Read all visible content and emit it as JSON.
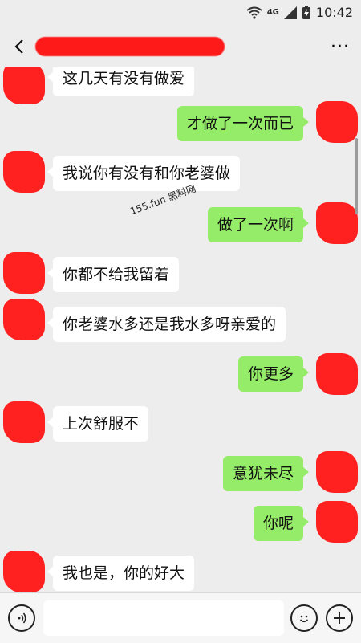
{
  "status_bar": {
    "network": "4G",
    "time": "10:42"
  },
  "icons": {
    "back": "back-chevron-icon",
    "more": "more-dots-icon",
    "wifi": "wifi-icon",
    "signal": "signal-icon",
    "battery": "battery-charging-icon",
    "voice": "voice-icon",
    "emoji": "emoji-icon",
    "plus": "plus-icon"
  },
  "watermark": "155.fun 黑料网",
  "messages": [
    {
      "side": "in",
      "text": "这几天有没有做爱"
    },
    {
      "side": "out",
      "text": "才做了一次而已"
    },
    {
      "side": "in",
      "text": "我说你有没有和你老婆做"
    },
    {
      "side": "out",
      "text": "做了一次啊"
    },
    {
      "side": "in",
      "text": "你都不给我留着"
    },
    {
      "side": "in",
      "text": "你老婆水多还是我水多呀亲爱的"
    },
    {
      "side": "out",
      "text": "你更多"
    },
    {
      "side": "in",
      "text": "上次舒服不"
    },
    {
      "side": "out",
      "text": "意犹未尽"
    },
    {
      "side": "out",
      "text": "你呢"
    },
    {
      "side": "in",
      "text": "我也是，你的好大"
    }
  ],
  "colors": {
    "background": "#ededed",
    "incoming_bubble": "#ffffff",
    "outgoing_bubble": "#95ec69",
    "redaction": "#ff2020"
  }
}
